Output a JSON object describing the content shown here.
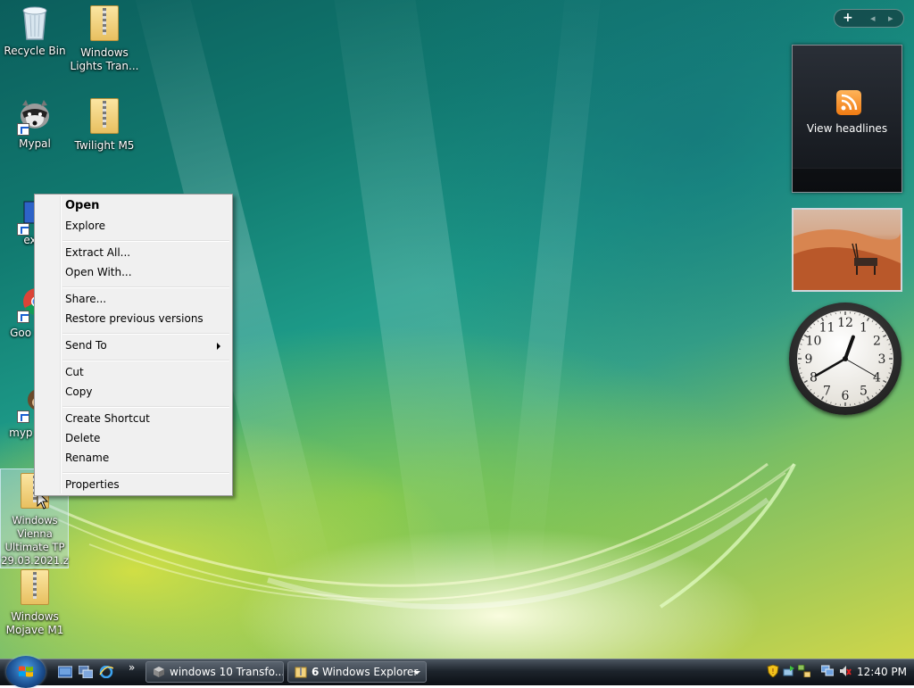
{
  "desktop": {
    "icons": [
      {
        "label": "Recycle Bin"
      },
      {
        "label": "Windows Lights Tran..."
      },
      {
        "label": "Mypal"
      },
      {
        "label": "Twilight M5"
      },
      {
        "label": "expl"
      },
      {
        "label": "Goo Chro"
      },
      {
        "label": "myp Shor"
      },
      {
        "label": "Windows Vienna Ultimate TP 29.03.2021.zi"
      },
      {
        "label": "Windows Mojave M1"
      }
    ]
  },
  "context_menu": {
    "items": [
      {
        "label": "Open",
        "bold": true
      },
      {
        "label": "Explore"
      },
      {
        "label": "Extract All..."
      },
      {
        "label": "Open With..."
      },
      {
        "label": "Share..."
      },
      {
        "label": "Restore previous versions"
      },
      {
        "label": "Send To",
        "submenu": true
      },
      {
        "label": "Cut"
      },
      {
        "label": "Copy"
      },
      {
        "label": "Create Shortcut"
      },
      {
        "label": "Delete"
      },
      {
        "label": "Rename"
      },
      {
        "label": "Properties"
      }
    ]
  },
  "sidebar": {
    "controls": {
      "add": "+",
      "prev": "◂",
      "next": "▸"
    },
    "feed_gadget": {
      "label": "View headlines",
      "icon": "rss-icon"
    },
    "slideshow_gadget": {
      "icon": "slideshow-image"
    },
    "clock_gadget": {
      "numerals": [
        "12",
        "1",
        "2",
        "3",
        "4",
        "5",
        "6",
        "7",
        "8",
        "9",
        "10",
        "11"
      ],
      "hour": 12,
      "minute": 40
    }
  },
  "taskbar": {
    "start_button": "start-orb",
    "quick_launch": [
      "show-desktop-icon",
      "switch-windows-icon",
      "internet-explorer-icon"
    ],
    "overflow": "»",
    "buttons": [
      {
        "label": "windows 10 Transfo...",
        "icon": "window-icon"
      },
      {
        "count": "6",
        "label": "Windows Explorer",
        "icon": "folder-icon"
      }
    ],
    "tray_icons": [
      "shield-icon",
      "safely-remove-icon",
      "network-icon",
      "monitor-icon",
      "volume-mute-icon"
    ],
    "time": "12:40 PM"
  },
  "colors": {
    "taskbar": "#1d242c",
    "menu_bg": "#f0f0f0",
    "rss": "#f07b12"
  }
}
